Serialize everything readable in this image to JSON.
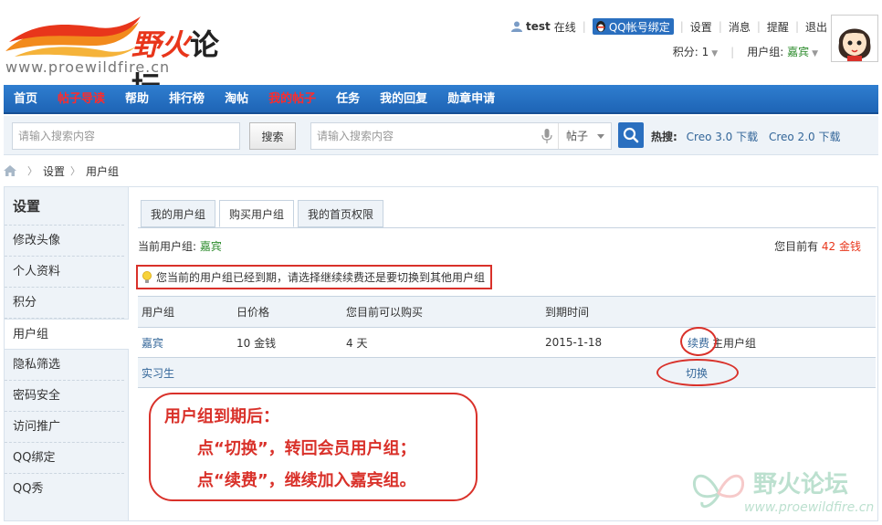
{
  "logo": {
    "text_red": "野火",
    "text_dark": "论坛",
    "url": "www.proewildfire.cn"
  },
  "topbar": {
    "username": "test",
    "status": "在线",
    "qq_bind": "QQ帐号绑定",
    "links": [
      "设置",
      "消息",
      "提醒",
      "退出"
    ]
  },
  "infobar": {
    "points_label": "积分: 1",
    "group_label": "用户组: ",
    "group_value": "嘉宾"
  },
  "nav": {
    "items": [
      {
        "label": "首页",
        "hot": false
      },
      {
        "label": "帖子导读",
        "hot": true
      },
      {
        "label": "帮助",
        "hot": false
      },
      {
        "label": "排行榜",
        "hot": false
      },
      {
        "label": "淘帖",
        "hot": false
      },
      {
        "label": "我的帖子",
        "hot": true
      },
      {
        "label": "任务",
        "hot": false
      },
      {
        "label": "我的回复",
        "hot": false
      },
      {
        "label": "勋章申请",
        "hot": false
      }
    ]
  },
  "search": {
    "placeholder1": "请输入搜索内容",
    "button": "搜索",
    "placeholder2": "请输入搜索内容",
    "type": "帖子",
    "hot_label": "热搜:",
    "hot_links": [
      "Creo 3.0 下载",
      "Creo 2.0 下载"
    ]
  },
  "breadcrumb": {
    "items": [
      "设置",
      "用户组"
    ]
  },
  "sidebar": {
    "title": "设置",
    "items": [
      "修改头像",
      "个人资料",
      "积分",
      "用户组",
      "隐私筛选",
      "密码安全",
      "访问推广",
      "QQ绑定",
      "QQ秀"
    ],
    "active_index": 3
  },
  "tabs": [
    "我的用户组",
    "购买用户组",
    "我的首页权限"
  ],
  "current_group": {
    "label": "当前用户组: ",
    "value": "嘉宾"
  },
  "balance": {
    "prefix": "您目前有 ",
    "amount": "42 金钱"
  },
  "notice": "您当前的用户组已经到期，请选择继续续费还是要切换到其他用户组",
  "table": {
    "headers": [
      "用户组",
      "日价格",
      "您目前可以购买",
      "到期时间",
      ""
    ],
    "rows": [
      {
        "group": "嘉宾",
        "price": "10 金钱",
        "can_buy": "4 天",
        "expire": "2015-1-18",
        "action": "续费",
        "action_suffix": "主用户组"
      },
      {
        "group": "实习生",
        "price": "",
        "can_buy": "",
        "expire": "",
        "action": "切换",
        "action_suffix": ""
      }
    ]
  },
  "callout": {
    "line1": "用户组到期后：",
    "line2": "点“切换”，转回会员用户组；",
    "line3": "点“续费”，继续加入嘉宾组。"
  },
  "watermark": {
    "cn": "野火论坛",
    "url": "www.proewildfire.cn"
  }
}
